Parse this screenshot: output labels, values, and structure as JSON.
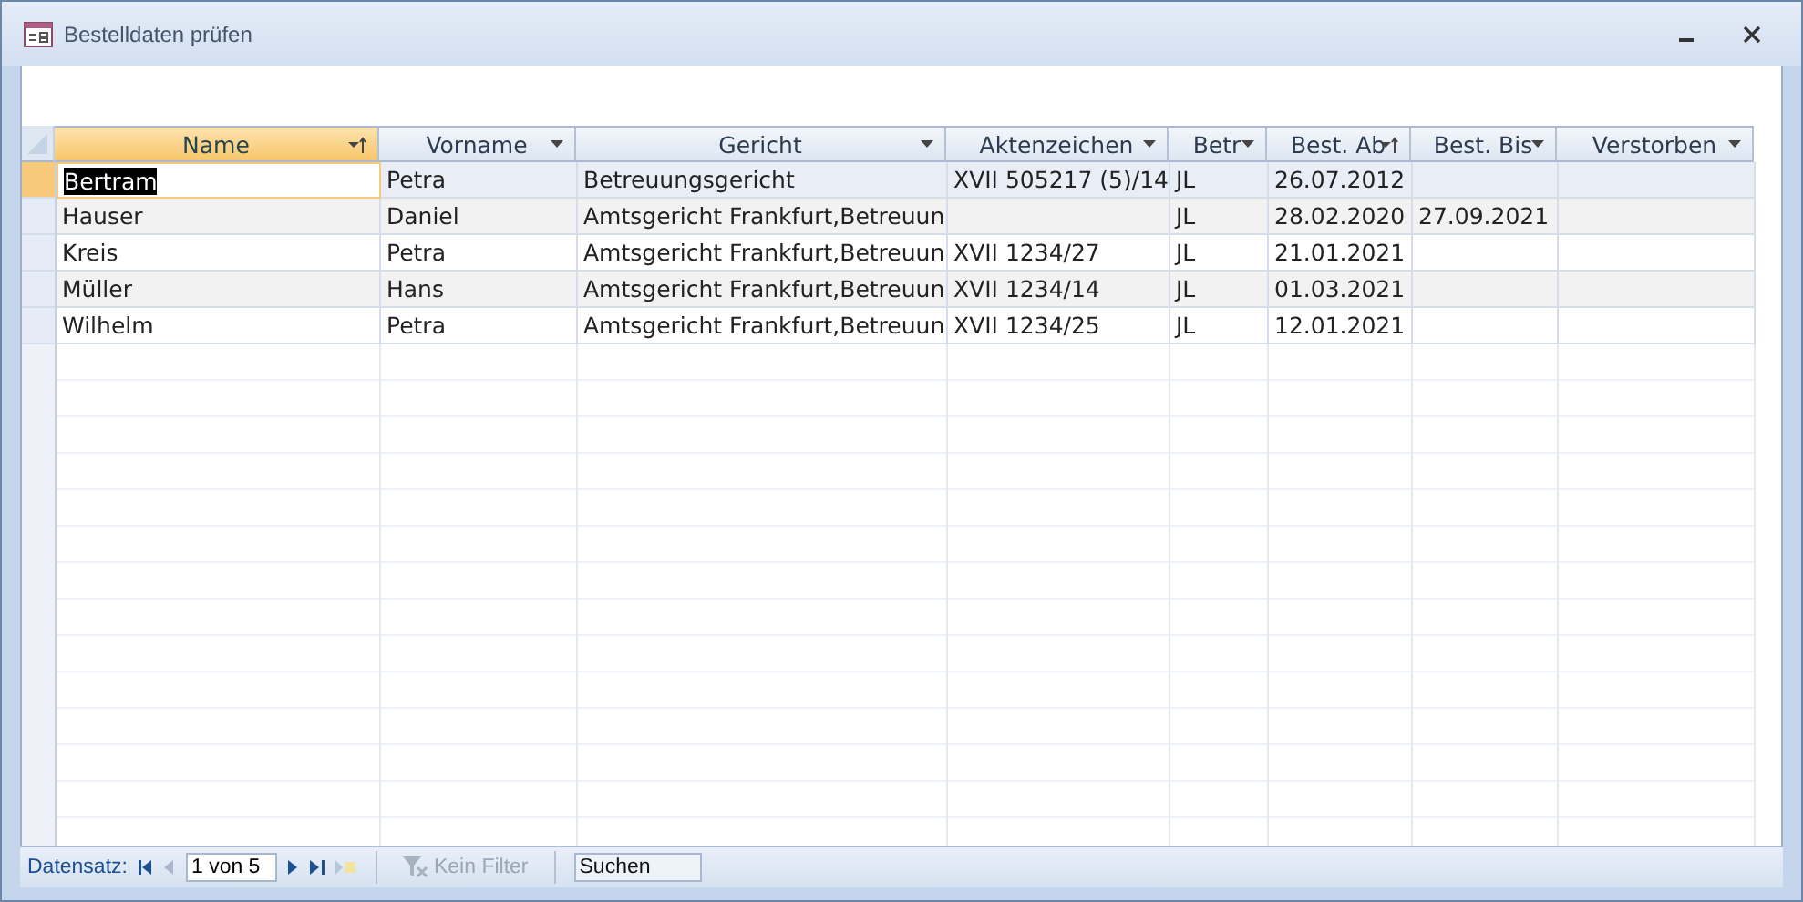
{
  "window": {
    "title": "Bestelldaten prüfen"
  },
  "table": {
    "columns": [
      {
        "label": "Name",
        "selected": true,
        "sorted": true
      },
      {
        "label": "Vorname",
        "selected": false,
        "sorted": false
      },
      {
        "label": "Gericht",
        "selected": false,
        "sorted": false
      },
      {
        "label": "Aktenzeichen",
        "selected": false,
        "sorted": false
      },
      {
        "label": "Betr",
        "selected": false,
        "sorted": false
      },
      {
        "label": "Best. Ab",
        "selected": false,
        "sorted": true
      },
      {
        "label": "Best. Bis",
        "selected": false,
        "sorted": false
      },
      {
        "label": "Verstorben",
        "selected": false,
        "sorted": false
      }
    ],
    "rows": [
      {
        "selected": true,
        "cells": [
          "Bertram",
          "Petra",
          "Betreuungsgericht",
          "XVII 505217 (5)/14",
          "JL",
          "26.07.2012",
          "",
          ""
        ]
      },
      {
        "selected": false,
        "cells": [
          "Hauser",
          "Daniel",
          "Amtsgericht Frankfurt,Betreuun",
          "",
          "JL",
          "28.02.2020",
          "27.09.2021",
          ""
        ]
      },
      {
        "selected": false,
        "cells": [
          "Kreis",
          "Petra",
          "Amtsgericht Frankfurt,Betreuun",
          "XVII 1234/27",
          "JL",
          "21.01.2021",
          "",
          ""
        ]
      },
      {
        "selected": false,
        "cells": [
          "Müller",
          "Hans",
          "Amtsgericht Frankfurt,Betreuun",
          "XVII 1234/14",
          "JL",
          "01.03.2021",
          "",
          ""
        ]
      },
      {
        "selected": false,
        "cells": [
          "Wilhelm",
          "Petra",
          "Amtsgericht Frankfurt,Betreuun",
          "XVII 1234/25",
          "JL",
          "12.01.2021",
          "",
          ""
        ]
      }
    ]
  },
  "status_bar": {
    "label": "Datensatz:",
    "record": "1 von 5",
    "filter": "Kein Filter",
    "search": {
      "placeholder": "Suchen"
    }
  }
}
